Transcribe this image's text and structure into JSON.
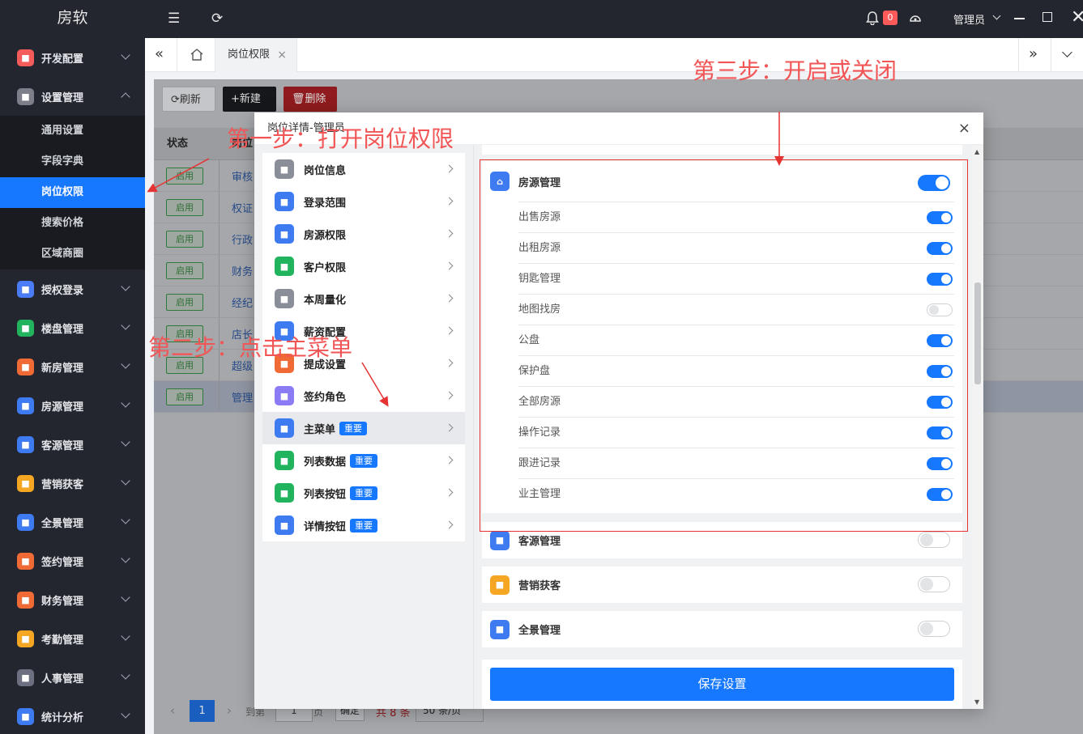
{
  "app": {
    "logo": "房软"
  },
  "sidebar": {
    "menus": [
      {
        "label": "开发配置",
        "icon": "gear-icon",
        "color": "#f45b5b",
        "expanded": false
      },
      {
        "label": "设置管理",
        "icon": "settings-icon",
        "color": "#7c7f8a",
        "expanded": true
      },
      {
        "label": "授权登录",
        "icon": "user-key-icon",
        "color": "#4a7cf6",
        "expanded": false
      },
      {
        "label": "楼盘管理",
        "icon": "building-icon",
        "color": "#21b35e",
        "expanded": false
      },
      {
        "label": "新房管理",
        "icon": "new-house-icon",
        "color": "#f06a36",
        "expanded": false
      },
      {
        "label": "房源管理",
        "icon": "house-icon",
        "color": "#3f7bf0",
        "expanded": false
      },
      {
        "label": "客源管理",
        "icon": "customer-icon",
        "color": "#3f7bf0",
        "expanded": false
      },
      {
        "label": "营销获客",
        "icon": "marketing-icon",
        "color": "#f5a623",
        "expanded": false
      },
      {
        "label": "全景管理",
        "icon": "vr-icon",
        "color": "#3f7bf0",
        "expanded": false
      },
      {
        "label": "签约管理",
        "icon": "contract-icon",
        "color": "#f06a36",
        "expanded": false
      },
      {
        "label": "财务管理",
        "icon": "finance-icon",
        "color": "#f06a36",
        "expanded": false
      },
      {
        "label": "考勤管理",
        "icon": "attendance-icon",
        "color": "#f5a623",
        "expanded": false
      },
      {
        "label": "人事管理",
        "icon": "hr-icon",
        "color": "#6c7080",
        "expanded": false
      },
      {
        "label": "统计分析",
        "icon": "stats-icon",
        "color": "#3f7bf0",
        "expanded": false
      }
    ],
    "submenu": [
      "通用设置",
      "字段字典",
      "岗位权限",
      "搜索价格",
      "区域商圈"
    ],
    "active_sub": "岗位权限"
  },
  "topbar": {
    "notification_count": "0",
    "user": "管理员"
  },
  "tabs": {
    "active": "岗位权限",
    "close": "×"
  },
  "toolbar": {
    "refresh": "⟳刷新",
    "new": "+新建",
    "delete": "🗑删除"
  },
  "table": {
    "col_status": "状态",
    "col_name": "岗位",
    "rows": [
      {
        "status": "启用",
        "name": "审核"
      },
      {
        "status": "启用",
        "name": "权证"
      },
      {
        "status": "启用",
        "name": "行政"
      },
      {
        "status": "启用",
        "name": "财务"
      },
      {
        "status": "启用",
        "name": "经纪"
      },
      {
        "status": "启用",
        "name": "店长"
      },
      {
        "status": "启用",
        "name": "超级"
      },
      {
        "status": "启用",
        "name": "管理"
      }
    ]
  },
  "pager": {
    "current": "1",
    "goto": "到第",
    "page_input": "1",
    "page": "页",
    "confirm": "确定",
    "total": "共 8 条",
    "size": "50 条/页"
  },
  "modal": {
    "title": "岗位详情-管理员",
    "close": "×",
    "left_items": [
      {
        "label": "岗位信息",
        "icon": "badge-icon",
        "color": "#8a8e99",
        "tag": ""
      },
      {
        "label": "登录范围",
        "icon": "shield-icon",
        "color": "#3f7bf0",
        "tag": ""
      },
      {
        "label": "房源权限",
        "icon": "house-icon",
        "color": "#3f7bf0",
        "tag": ""
      },
      {
        "label": "客户权限",
        "icon": "customer-icon",
        "color": "#21b35e",
        "tag": ""
      },
      {
        "label": "本周量化",
        "icon": "chart-icon",
        "color": "#8a8e99",
        "tag": ""
      },
      {
        "label": "薪资配置",
        "icon": "salary-icon",
        "color": "#3f7bf0",
        "tag": ""
      },
      {
        "label": "提成设置",
        "icon": "commission-icon",
        "color": "#f06a36",
        "tag": ""
      },
      {
        "label": "签约角色",
        "icon": "role-icon",
        "color": "#8b7cf6",
        "tag": ""
      },
      {
        "label": "主菜单",
        "icon": "menu-icon",
        "color": "#3f7bf0",
        "tag": "重要"
      },
      {
        "label": "列表数据",
        "icon": "list-icon",
        "color": "#21b35e",
        "tag": "重要"
      },
      {
        "label": "列表按钮",
        "icon": "click-icon",
        "color": "#21b35e",
        "tag": "重要"
      },
      {
        "label": "详情按钮",
        "icon": "pointer-icon",
        "color": "#3f7bf0",
        "tag": "重要"
      }
    ],
    "active_left": "主菜单",
    "main_card": {
      "title": "房源管理",
      "enabled": true,
      "perms": [
        {
          "label": "出售房源",
          "on": true
        },
        {
          "label": "出租房源",
          "on": true
        },
        {
          "label": "钥匙管理",
          "on": true
        },
        {
          "label": "地图找房",
          "on": false
        },
        {
          "label": "公盘",
          "on": true
        },
        {
          "label": "保护盘",
          "on": true
        },
        {
          "label": "全部房源",
          "on": true
        },
        {
          "label": "操作记录",
          "on": true
        },
        {
          "label": "跟进记录",
          "on": true
        },
        {
          "label": "业主管理",
          "on": true
        }
      ]
    },
    "other_cards": [
      {
        "title": "客源管理",
        "icon": "customer-icon",
        "color": "#3f7bf0",
        "enabled": false
      },
      {
        "title": "营销获客",
        "icon": "marketing-icon",
        "color": "#f5a623",
        "enabled": false
      },
      {
        "title": "全景管理",
        "icon": "vr-icon",
        "color": "#3f7bf0",
        "enabled": false
      }
    ],
    "save_label": "保存设置"
  },
  "annotations": {
    "step1": "第一步：打开岗位权限",
    "step2": "第二步：点击主菜单",
    "step3": "第三步：开启或关闭"
  }
}
